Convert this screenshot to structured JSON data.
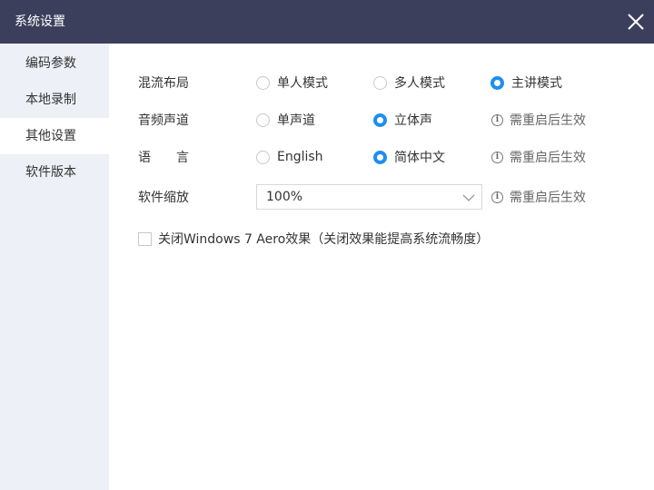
{
  "window": {
    "title": "系统设置",
    "close_icon": "close-icon"
  },
  "sidebar": {
    "items": [
      {
        "label": "编码参数",
        "active": false
      },
      {
        "label": "本地录制",
        "active": false
      },
      {
        "label": "其他设置",
        "active": true
      },
      {
        "label": "软件版本",
        "active": false
      }
    ]
  },
  "settings": {
    "mix_layout": {
      "label": "混流布局",
      "options": [
        "单人模式",
        "多人模式",
        "主讲模式"
      ],
      "selected": "主讲模式"
    },
    "audio_channel": {
      "label": "音频声道",
      "options": [
        "单声道",
        "立体声"
      ],
      "selected": "立体声",
      "hint": "需重启后生效"
    },
    "language": {
      "label_1": "语",
      "label_2": "言",
      "options": [
        "English",
        "简体中文"
      ],
      "selected": "简体中文",
      "hint": "需重启后生效"
    },
    "zoom": {
      "label": "软件缩放",
      "value": "100%",
      "hint": "需重启后生效"
    },
    "aero": {
      "label": "关闭Windows 7 Aero效果（关闭效果能提高系统流畅度）",
      "checked": false
    }
  },
  "colors": {
    "titlebar": "#3c3f5c",
    "sidebar": "#eef0f8",
    "accent": "#1e8ef0"
  }
}
